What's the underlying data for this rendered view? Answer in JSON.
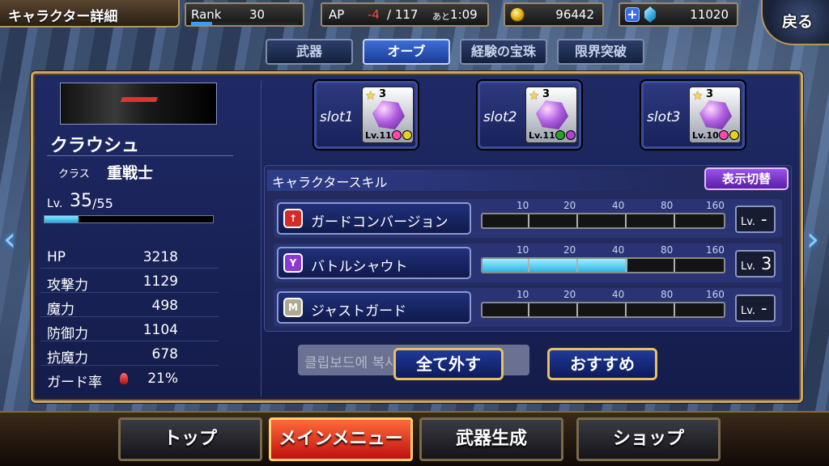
{
  "header": {
    "title": "キャラクター詳細",
    "rank": {
      "label": "Rank",
      "value": "30",
      "progress": 0.2
    },
    "ap": {
      "label": "AP",
      "current": "-4",
      "max": "/ 117",
      "next_label": "あと",
      "next_time": "1:09"
    },
    "gil": {
      "value": "96442",
      "icon": "gold-coin-icon"
    },
    "gems": {
      "value": "11020",
      "icon": "blue-crystal-icon"
    },
    "back_label": "戻る"
  },
  "tabs": [
    {
      "label": "武器",
      "active": false
    },
    {
      "label": "オーブ",
      "active": true
    },
    {
      "label": "経験の宝珠",
      "active": false
    },
    {
      "label": "限界突破",
      "active": false
    }
  ],
  "character": {
    "name": "クラウシュ",
    "class_label": "クラス",
    "class_value": "重戦士",
    "level_prefix": "Lv.",
    "level": "35",
    "level_max": "/55",
    "level_progress": 0.2,
    "stats": [
      {
        "label": "HP",
        "value": "3218"
      },
      {
        "label": "攻撃力",
        "value": "1129"
      },
      {
        "label": "魔力",
        "value": "498"
      },
      {
        "label": "防御力",
        "value": "1104"
      },
      {
        "label": "抗魔力",
        "value": "678"
      },
      {
        "label": "ガード率",
        "value": "21%"
      }
    ]
  },
  "slots": [
    {
      "label": "slot1",
      "stars": "3",
      "level": "Lv.11",
      "gems": [
        "#ff4aa8",
        "#e8d020"
      ]
    },
    {
      "label": "slot2",
      "stars": "3",
      "level": "Lv.11",
      "gems": [
        "#2aa02a",
        "#b040d0"
      ]
    },
    {
      "label": "slot3",
      "stars": "3",
      "level": "Lv.10",
      "gems": [
        "#ff4aa8",
        "#e8d020"
      ]
    }
  ],
  "skills": {
    "header": "キャラクタースキル",
    "toggle_label": "表示切替",
    "ticks": [
      "10",
      "20",
      "40",
      "80",
      "160"
    ],
    "items": [
      {
        "name": "ガードコンバージョン",
        "icon": "red-shield-arrow-icon",
        "icon_color": "#d42a2a",
        "icon_glyph": "↑",
        "fill": 0,
        "lv_prefix": "Lv.",
        "lv": "-"
      },
      {
        "name": "バトルシャウト",
        "icon": "purple-rune-icon",
        "icon_color": "#8a3ad0",
        "icon_glyph": "Y",
        "fill": 0.6,
        "lv_prefix": "Lv.",
        "lv": "3"
      },
      {
        "name": "ジャストガード",
        "icon": "gray-shield-m-icon",
        "icon_color": "#b0a890",
        "icon_glyph": "M",
        "fill": 0,
        "lv_prefix": "Lv.",
        "lv": "-"
      }
    ]
  },
  "clipboard_toast": "클립보드에 복사되었습니다.",
  "buttons": {
    "unequip": "全て外す",
    "recommend": "おすすめ"
  },
  "nav": [
    {
      "label": "トップ",
      "active": false
    },
    {
      "label": "メインメニュー",
      "active": true
    },
    {
      "label": "武器生成",
      "active": false
    },
    {
      "label": "ショップ",
      "active": false
    }
  ]
}
